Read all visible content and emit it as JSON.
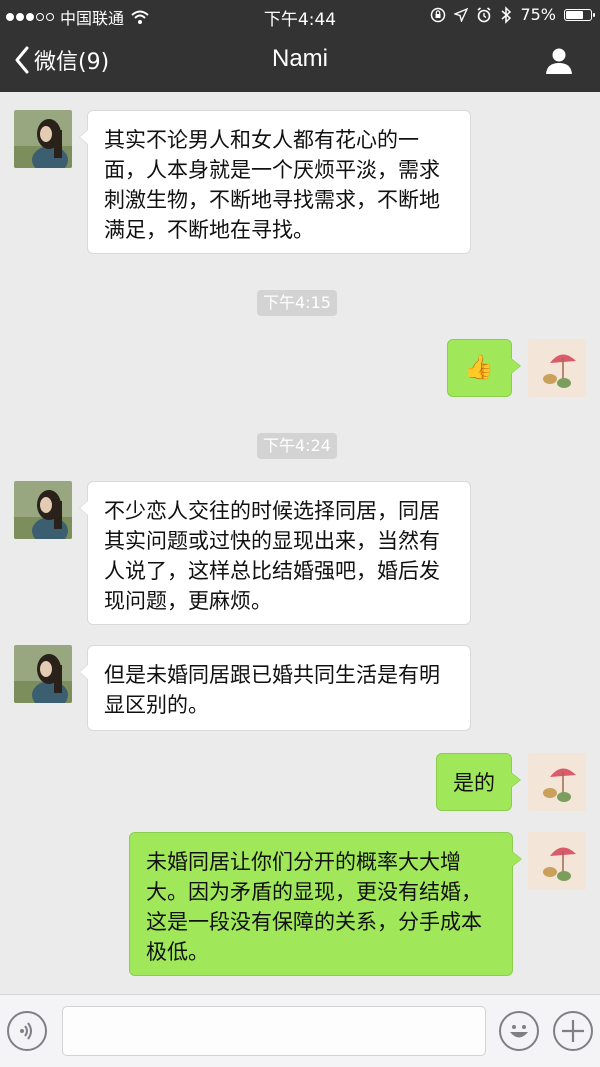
{
  "status_bar": {
    "carrier": "中国联通",
    "time": "下午4:44",
    "battery": "75%",
    "battery_level": 0.75
  },
  "nav": {
    "back_label": "微信(9)",
    "title": "Nami"
  },
  "messages": [
    {
      "side": "in",
      "text": "其实不论男人和女人都有花心的一面，人本身就是一个厌烦平淡，需求刺激生物，不断地寻找需求，不断地满足，不断地在寻找。"
    },
    {
      "type": "time",
      "text": "下午4:15"
    },
    {
      "side": "out",
      "emoji": "👍"
    },
    {
      "type": "time",
      "text": "下午4:24"
    },
    {
      "side": "in",
      "text": "不少恋人交往的时候选择同居，同居其实问题或过快的显现出来，当然有人说了，这样总比结婚强吧，婚后发现问题，更麻烦。"
    },
    {
      "side": "in",
      "text": "但是未婚同居跟已婚共同生活是有明显区别的。"
    },
    {
      "side": "out",
      "text": "是的"
    },
    {
      "side": "out",
      "text": "未婚同居让你们分开的概率大大增大。因为矛盾的显现，更没有结婚，这是一段没有保障的关系，分手成本极低。"
    }
  ],
  "input": {
    "value": ""
  },
  "colors": {
    "nav_bg": "#333334",
    "chat_bg": "#ebebeb",
    "outgoing_bubble": "#a0e75a",
    "incoming_bubble": "#ffffff",
    "timestamp_bg": "#d3d3d3"
  },
  "icons": {
    "back": "chevron-left-icon",
    "profile": "person-icon",
    "voice": "voice-icon",
    "emoji": "smiley-icon",
    "more": "plus-icon",
    "wifi": "wifi-icon",
    "lock": "rotation-lock-icon",
    "location": "location-arrow-icon",
    "alarm": "alarm-icon",
    "bluetooth": "bluetooth-icon"
  }
}
